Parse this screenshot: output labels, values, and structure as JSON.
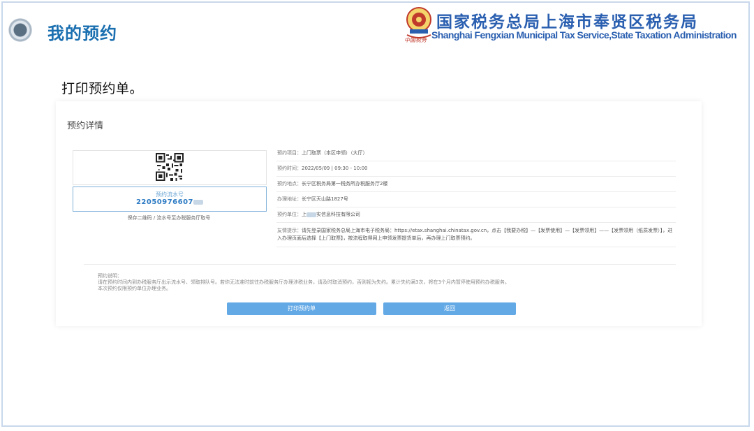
{
  "slide": {
    "title": "我的预约",
    "step_text": "打印预约单。"
  },
  "header": {
    "org_cn": "国家税务总局上海市奉贤区税务局",
    "org_en": "Shanghai Fengxian Municipal Tax Service,State Taxation Administration",
    "logo_caption": "中国税务"
  },
  "panel": {
    "title": "预约详情",
    "serial_label": "预约流水号",
    "serial_value": "22050976607",
    "save_hint": "保存二维码 / 流水号至办税服务厅取号",
    "details": [
      {
        "key": "预约项目：",
        "value": "上门取票（本区申领）（大厅）"
      },
      {
        "key": "预约时间：",
        "value": "2022/05/09 | 09:30 - 10:00"
      },
      {
        "key": "预约地点：",
        "value": "长宁区税务局第一税务所办税服务厅2楼"
      },
      {
        "key": "办理地址：",
        "value": "长宁区天山路1827号"
      },
      {
        "key": "预约单位：",
        "value_prefix": "上",
        "value_suffix": "实信息科技有限公司"
      },
      {
        "key": "友情提示：",
        "value": "请先登录国家税务总局上海市电子税务局：https://etax.shanghai.chinatax.gov.cn，点击【我要办税】—【发票使用】—【发票领用】——【发票领用（纸质发票）】，进入办理页面后选择【上门取票】，按流程取得网上申领发票提货单后，再办理上门取票预约。"
      }
    ],
    "notes": [
      "预约说明：",
      "请在预约时间内到办税服务厅出示流水号、领取排队号。若你无法准时前往办税服务厅办理涉税业务，请及时取消预约，否则视为失约。累计失约满3次，将在3个月内暂停使用预约办税服务。",
      "本次预约仅限预约单位办理业务。"
    ],
    "buttons": {
      "print": "打印预约单",
      "back": "返回"
    }
  }
}
